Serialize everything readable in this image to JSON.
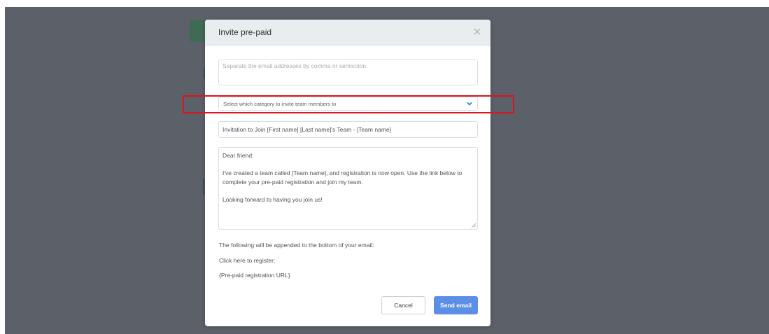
{
  "modal": {
    "title": "Invite pre-paid",
    "close_icon": "close-icon",
    "email_placeholder": "Separate the email addresses by comma or semicolon.",
    "category_select": {
      "selected": "Select which category to invite team members to",
      "icon": "chevron-down-icon"
    },
    "subject_value": "Invitation to Join [First name] [Last name]'s Team - [Team name]",
    "message_lines": [
      "Dear friend:",
      "I've created a team called [Team name], and registration is now open. Use the link below to complete your pre-paid registration and join my team.",
      "Looking forward to having you join us!"
    ],
    "append_note": "The following will be appended to the bottom of your email:",
    "click_here": "Click here to register:",
    "url_placeholder": "{Pre-paid registration URL}",
    "cancel_label": "Cancel",
    "send_label": "Send email"
  },
  "colors": {
    "overlay": "#5c6068",
    "header_bg": "#e8eef0",
    "primary": "#5b8ee6",
    "highlight": "#e0131b"
  }
}
